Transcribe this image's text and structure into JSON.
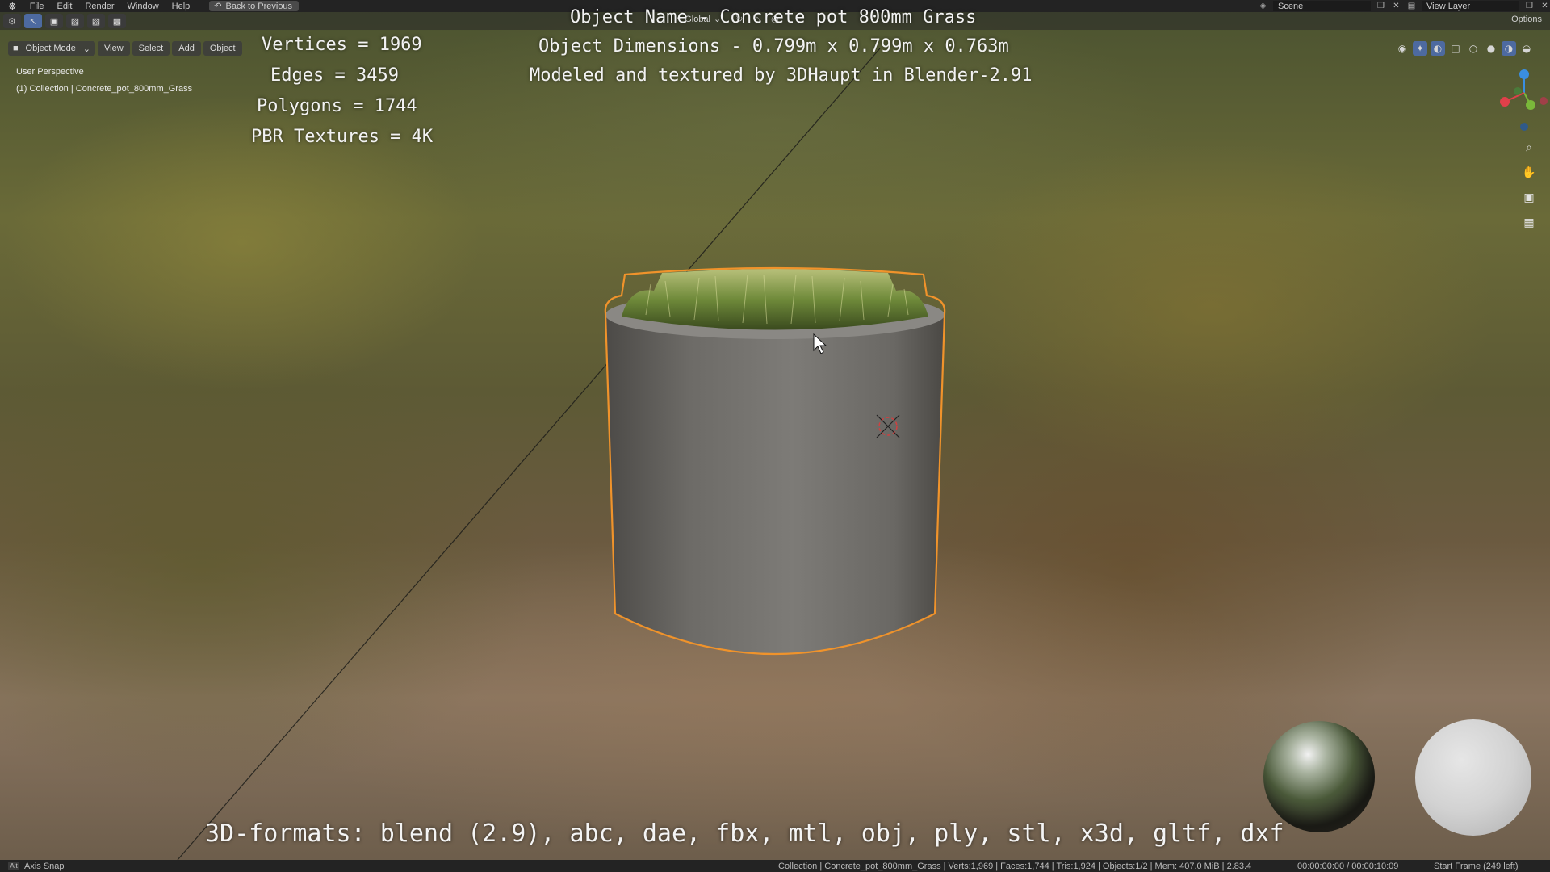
{
  "menubar": {
    "items": [
      "File",
      "Edit",
      "Render",
      "Window",
      "Help"
    ],
    "back_button": "Back to Previous",
    "scene": "Scene",
    "view_layer": "View Layer"
  },
  "toolbar": {
    "orientation": "Global",
    "options": "Options"
  },
  "viewport_header": {
    "mode": "Object Mode",
    "menus": [
      "View",
      "Select",
      "Add",
      "Object"
    ]
  },
  "viewport": {
    "perspective": "User Perspective",
    "collection": "(1) Collection | Concrete_pot_800mm_Grass"
  },
  "overlay": {
    "vertices": "Vertices = 1969",
    "edges": "Edges = 3459",
    "polygons": "Polygons = 1744",
    "pbr": "PBR Textures = 4K",
    "object_name": "Object Name - Concrete pot 800mm Grass",
    "dimensions": "Object Dimensions -  0.799m x 0.799m x 0.763m",
    "modeled_by": "Modeled and textured by 3DHaupt in Blender-2.91",
    "formats": "3D-formats: blend (2.9), abc, dae, fbx, mtl, obj, ply, stl, x3d, gltf, dxf"
  },
  "statusbar": {
    "key": "Alt",
    "left": "Axis Snap",
    "stats": "Collection | Concrete_pot_800mm_Grass | Verts:1,969 | Faces:1,744 | Tris:1,924 | Objects:1/2 | Mem: 407.0 MiB | 2.83.4",
    "time": "00:00:00:00 / 00:00:10:09",
    "frame": "Start Frame (249 left)"
  },
  "colors": {
    "selection_outline": "#f0932b",
    "active_blue": "#4d6aa0",
    "axis_x": "#e0404a",
    "axis_y": "#7ab83a",
    "axis_z": "#3a8ee0"
  }
}
